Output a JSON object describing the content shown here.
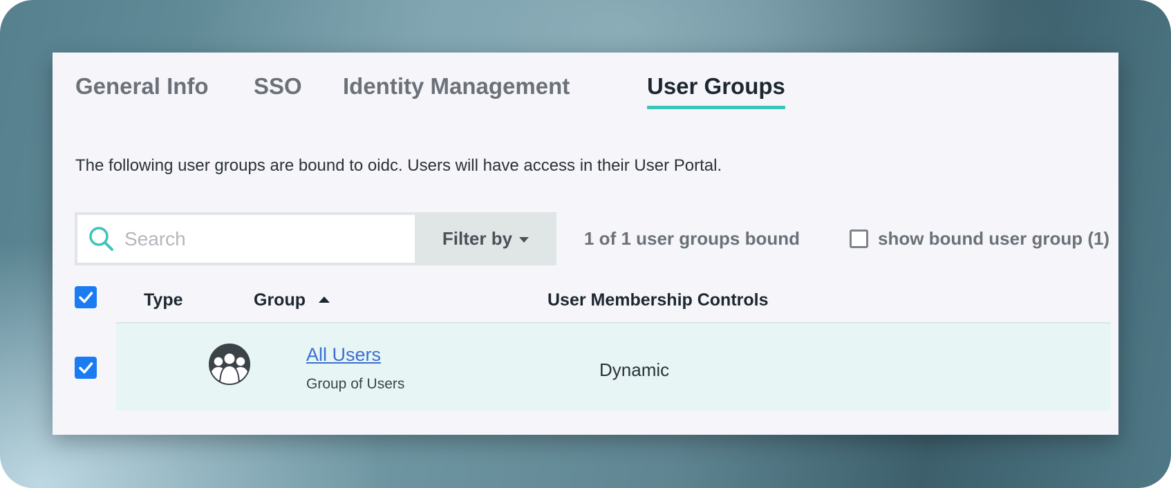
{
  "tabs": [
    {
      "label": "General Info",
      "active": false
    },
    {
      "label": "SSO",
      "active": false
    },
    {
      "label": "Identity Management",
      "active": false
    },
    {
      "label": "User Groups",
      "active": true
    }
  ],
  "intro_text": "The following user groups are bound to oidc. Users will have access in their User Portal.",
  "search": {
    "placeholder": "Search",
    "value": ""
  },
  "filter": {
    "label": "Filter by"
  },
  "bound_count": "1 of 1 user groups bound",
  "show_bound": {
    "label": "show bound user group (1)",
    "checked": false
  },
  "table": {
    "select_all_checked": true,
    "columns": {
      "type": "Type",
      "group": "Group",
      "membership": "User Membership Controls"
    },
    "sort": {
      "column": "group",
      "direction": "ascending"
    },
    "rows": [
      {
        "checked": true,
        "type_icon": "user-group-icon",
        "group_name": "All Users",
        "group_sub": "Group of Users",
        "membership": "Dynamic"
      }
    ]
  },
  "colors": {
    "accent": "#3cc4b9",
    "checkbox": "#1a7cf0",
    "link": "#3a6fd0",
    "row_highlight": "#e7f6f5"
  }
}
